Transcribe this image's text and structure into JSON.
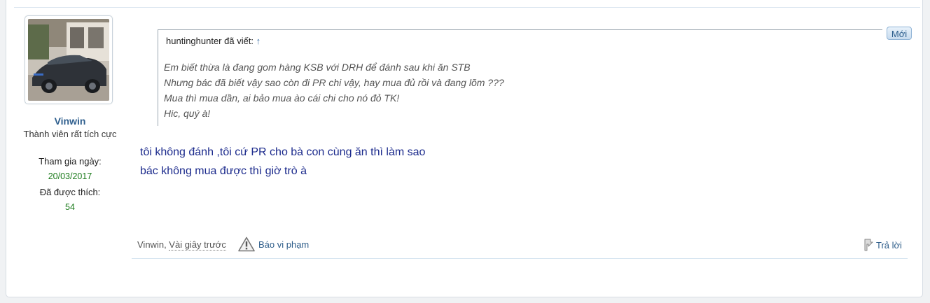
{
  "user": {
    "name": "Vinwin",
    "title": "Thành viên rất tích cực",
    "joined_label": "Tham gia ngày:",
    "joined_value": "20/03/2017",
    "likes_label": "Đã được thích:",
    "likes_value": "54"
  },
  "post": {
    "badge": "Mới",
    "quote": {
      "author_line": "huntinghunter đã viết:",
      "arrow": "↑",
      "lines": [
        "Em biết thừa là đang gom hàng KSB với DRH để đánh sau khi ăn STB",
        "Nhưng bác đã biết vậy sao còn đi PR chi vậy, hay mua đủ rồi và đang lõm ???",
        "Mua thì mua dần, ai bảo mua ào cái chi cho nó đỏ TK!",
        "Hic, quý à!"
      ]
    },
    "message_lines": [
      "tôi không đánh ,tôi cứ PR cho bà con cùng ăn thì làm sao",
      "bác không mua được thì giờ trò à"
    ]
  },
  "footer": {
    "author": "Vinwin",
    "separator": ", ",
    "time": "Vài giây trước",
    "report_label": "Báo vi phạm",
    "reply_label": "Trả lời"
  },
  "icons": {
    "warning": "warning-icon",
    "reply": "reply-icon"
  },
  "colors": {
    "username": "#2f5f8e",
    "stat_value": "#1a7a1a",
    "message_text": "#1b2a8c",
    "link": "#2e5d8a"
  }
}
